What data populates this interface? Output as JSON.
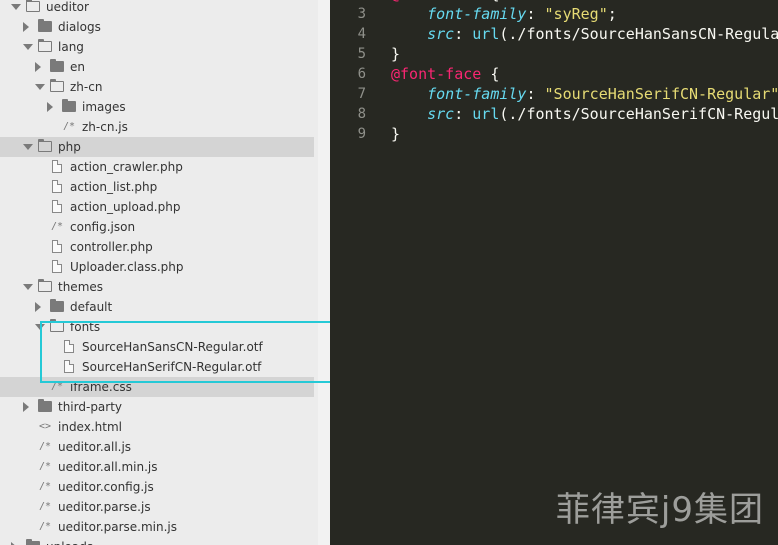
{
  "sidebar": {
    "items": [
      {
        "label": "ueditor",
        "type": "folder",
        "open": true,
        "indent": 0,
        "glyph": ""
      },
      {
        "label": "dialogs",
        "type": "folder",
        "open": false,
        "indent": 1,
        "glyph": ""
      },
      {
        "label": "lang",
        "type": "folder",
        "open": true,
        "indent": 1,
        "glyph": ""
      },
      {
        "label": "en",
        "type": "folder",
        "open": false,
        "indent": 2,
        "glyph": ""
      },
      {
        "label": "zh-cn",
        "type": "folder",
        "open": true,
        "indent": 2,
        "glyph": ""
      },
      {
        "label": "images",
        "type": "folder",
        "open": false,
        "indent": 3,
        "glyph": ""
      },
      {
        "label": "zh-cn.js",
        "type": "code",
        "indent": 3,
        "glyph": "/*"
      },
      {
        "label": "php",
        "type": "folder",
        "open": true,
        "indent": 1,
        "glyph": "",
        "selected": true
      },
      {
        "label": "action_crawler.php",
        "type": "file",
        "indent": 2,
        "glyph": ""
      },
      {
        "label": "action_list.php",
        "type": "file",
        "indent": 2,
        "glyph": ""
      },
      {
        "label": "action_upload.php",
        "type": "file",
        "indent": 2,
        "glyph": ""
      },
      {
        "label": "config.json",
        "type": "code",
        "indent": 2,
        "glyph": "/*"
      },
      {
        "label": "controller.php",
        "type": "file",
        "indent": 2,
        "glyph": ""
      },
      {
        "label": "Uploader.class.php",
        "type": "file",
        "indent": 2,
        "glyph": ""
      },
      {
        "label": "themes",
        "type": "folder",
        "open": true,
        "indent": 1,
        "glyph": ""
      },
      {
        "label": "default",
        "type": "folder",
        "open": false,
        "indent": 2,
        "glyph": ""
      },
      {
        "label": "fonts",
        "type": "folder",
        "open": true,
        "indent": 2,
        "glyph": ""
      },
      {
        "label": "SourceHanSansCN-Regular.otf",
        "type": "file",
        "indent": 3,
        "glyph": ""
      },
      {
        "label": "SourceHanSerifCN-Regular.otf",
        "type": "file",
        "indent": 3,
        "glyph": ""
      },
      {
        "label": "iframe.css",
        "type": "code",
        "indent": 2,
        "glyph": "/*",
        "selected": true
      },
      {
        "label": "third-party",
        "type": "folder",
        "open": false,
        "indent": 1,
        "glyph": ""
      },
      {
        "label": "index.html",
        "type": "code",
        "indent": 1,
        "glyph": "<>"
      },
      {
        "label": "ueditor.all.js",
        "type": "code",
        "indent": 1,
        "glyph": "/*"
      },
      {
        "label": "ueditor.all.min.js",
        "type": "code",
        "indent": 1,
        "glyph": "/*"
      },
      {
        "label": "ueditor.config.js",
        "type": "code",
        "indent": 1,
        "glyph": "/*"
      },
      {
        "label": "ueditor.parse.js",
        "type": "code",
        "indent": 1,
        "glyph": "/*"
      },
      {
        "label": "ueditor.parse.min.js",
        "type": "code",
        "indent": 1,
        "glyph": "/*"
      },
      {
        "label": "uploads",
        "type": "folder",
        "open": false,
        "indent": 0,
        "glyph": ""
      }
    ]
  },
  "editor": {
    "lines": [
      {
        "num": "3",
        "tokens": [
          {
            "t": "    "
          },
          {
            "t": "font-family",
            "c": "prop"
          },
          {
            "t": ": "
          },
          {
            "t": "\"syReg\"",
            "c": "str"
          },
          {
            "t": ";"
          }
        ]
      },
      {
        "num": "4",
        "tokens": [
          {
            "t": "    "
          },
          {
            "t": "src",
            "c": "prop"
          },
          {
            "t": ": "
          },
          {
            "t": "url",
            "c": "fn"
          },
          {
            "t": "(./fonts/SourceHanSansCN-Regular.otf);"
          }
        ]
      },
      {
        "num": "5",
        "tokens": [
          {
            "t": "}"
          }
        ]
      },
      {
        "num": "6",
        "tokens": [
          {
            "t": "@font-face",
            "c": "at"
          },
          {
            "t": " {"
          }
        ]
      },
      {
        "num": "7",
        "tokens": [
          {
            "t": "    "
          },
          {
            "t": "font-family",
            "c": "prop"
          },
          {
            "t": ": "
          },
          {
            "t": "\"SourceHanSerifCN-Regular\"",
            "c": "str"
          },
          {
            "t": ";"
          }
        ]
      },
      {
        "num": "8",
        "tokens": [
          {
            "t": "    "
          },
          {
            "t": "src",
            "c": "prop"
          },
          {
            "t": ": "
          },
          {
            "t": "url",
            "c": "fn"
          },
          {
            "t": "(./fonts/SourceHanSerifCN-Regular.otf);"
          }
        ]
      },
      {
        "num": "9",
        "tokens": [
          {
            "t": "}"
          }
        ]
      }
    ]
  },
  "watermark": "菲律宾j9集团",
  "colors": {
    "highlight": "#25c9d6",
    "editor_bg": "#272822"
  }
}
